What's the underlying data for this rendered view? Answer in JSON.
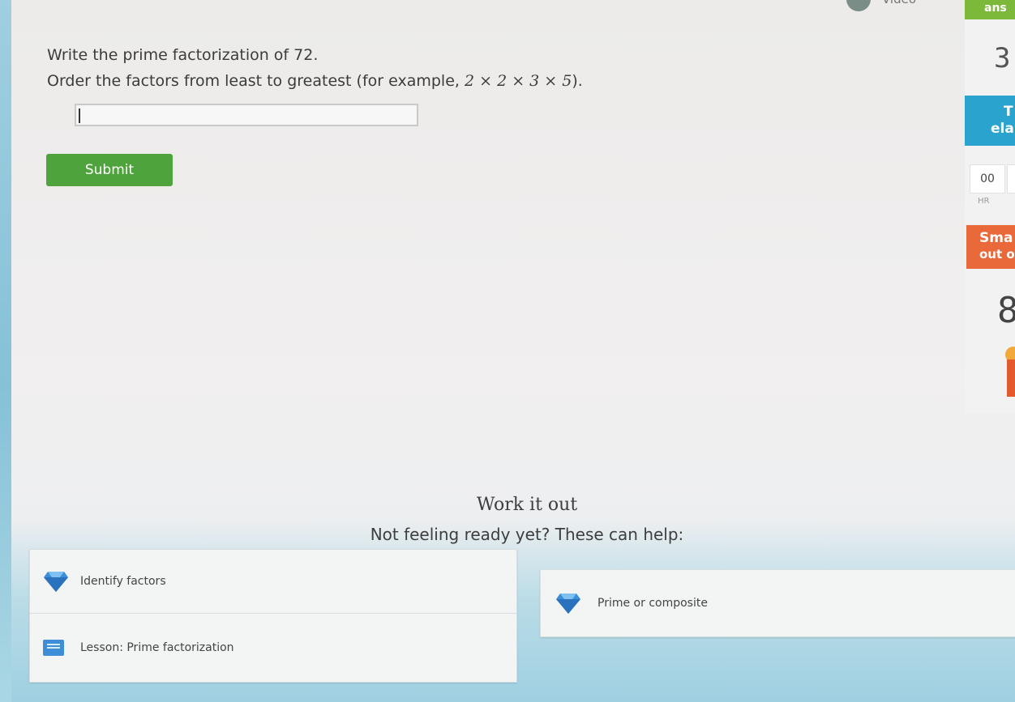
{
  "question": {
    "line1": "Write the prime factorization of 72.",
    "line2_prefix": "Order the factors from least to greatest (for example, ",
    "example_math": "2 × 2 × 3 × 5",
    "line2_suffix": ")."
  },
  "answer": {
    "value": "",
    "placeholder": ""
  },
  "submit_label": "Submit",
  "work_it_out": {
    "title": "Work it out",
    "prompt": "Not feeling ready yet? These can help:",
    "items": [
      {
        "label": "Identify factors",
        "icon": "diamond-icon"
      },
      {
        "label": "Prime or composite",
        "icon": "diamond-icon"
      },
      {
        "label": "Lesson: Prime factorization",
        "icon": "lesson-icon"
      }
    ]
  },
  "sidebar": {
    "answered_label": "ans",
    "answered_count": "3",
    "time_title": "T",
    "time_subtitle": "ela",
    "hours_value": "00",
    "hours_label": "HR",
    "score_title": "Sma",
    "score_subtitle": "out o",
    "score_value": "8"
  },
  "header": {
    "video_label": "Video"
  },
  "colors": {
    "submit": "#4fa33c",
    "answered_header": "#7cb83a",
    "time_box": "#2ba3cf",
    "score_box": "#e9693a",
    "diamond": "#3b8fd9"
  }
}
